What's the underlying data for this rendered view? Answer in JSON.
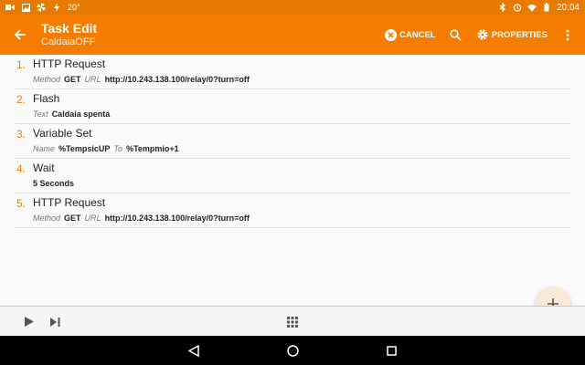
{
  "status_bar": {
    "temperature": "20°",
    "time": "20:04"
  },
  "app_bar": {
    "title": "Task Edit",
    "subtitle": "CaldaiaOFF",
    "cancel_label": "CANCEL",
    "properties_label": "PROPERTIES"
  },
  "actions": [
    {
      "number": "1.",
      "name": "HTTP Request",
      "args": [
        {
          "label": "Method",
          "value": "GET"
        },
        {
          "label": "URL",
          "value": "http://10.243.138.100/relay/0?turn=off"
        }
      ]
    },
    {
      "number": "2.",
      "name": "Flash",
      "args": [
        {
          "label": "Text",
          "value": "Caldaia spenta"
        }
      ]
    },
    {
      "number": "3.",
      "name": "Variable Set",
      "args": [
        {
          "label": "Name",
          "value": "%TempsicUP"
        },
        {
          "label": "To",
          "value": "%Tempmio+1"
        }
      ]
    },
    {
      "number": "4.",
      "name": "Wait",
      "args": [
        {
          "label": "",
          "value": "5 Seconds"
        }
      ]
    },
    {
      "number": "5.",
      "name": "HTTP Request",
      "args": [
        {
          "label": "Method",
          "value": "GET"
        },
        {
          "label": "URL",
          "value": "http://10.243.138.100/relay/0?turn=off"
        }
      ]
    }
  ],
  "colors": {
    "primary": "#f57c00",
    "status_bar": "#e67b00",
    "fab": "#fbe9d7"
  }
}
